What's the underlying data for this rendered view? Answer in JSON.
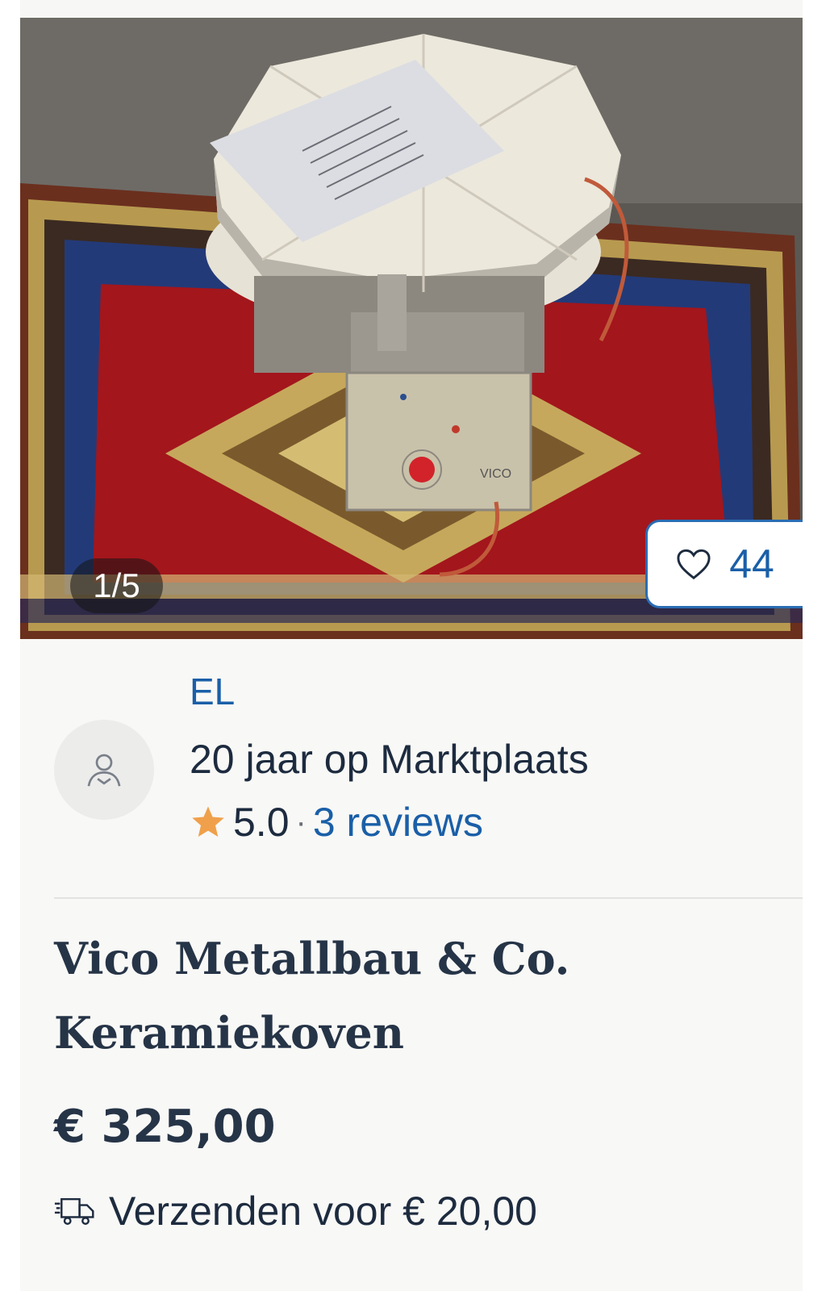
{
  "gallery": {
    "counter": "1/5",
    "favorite_count": "44"
  },
  "seller": {
    "name": "EL",
    "membership": "20 jaar op Marktplaats",
    "rating": "5.0",
    "separator": "·",
    "reviews": "3 reviews"
  },
  "listing": {
    "title_line1": "Vico Metallbau & Co.",
    "title_line2": "Keramiekoven",
    "price": "€ 325,00",
    "shipping": "Verzenden voor € 20,00"
  },
  "icons": {
    "favorite": "heart-outline-icon",
    "avatar": "user-icon",
    "rating": "star-icon",
    "shipping": "delivery-truck-icon"
  },
  "colors": {
    "link": "#1a5fa8",
    "text": "#1d2b3f",
    "star": "#f0a04b",
    "accent_border": "#2a6db3"
  }
}
